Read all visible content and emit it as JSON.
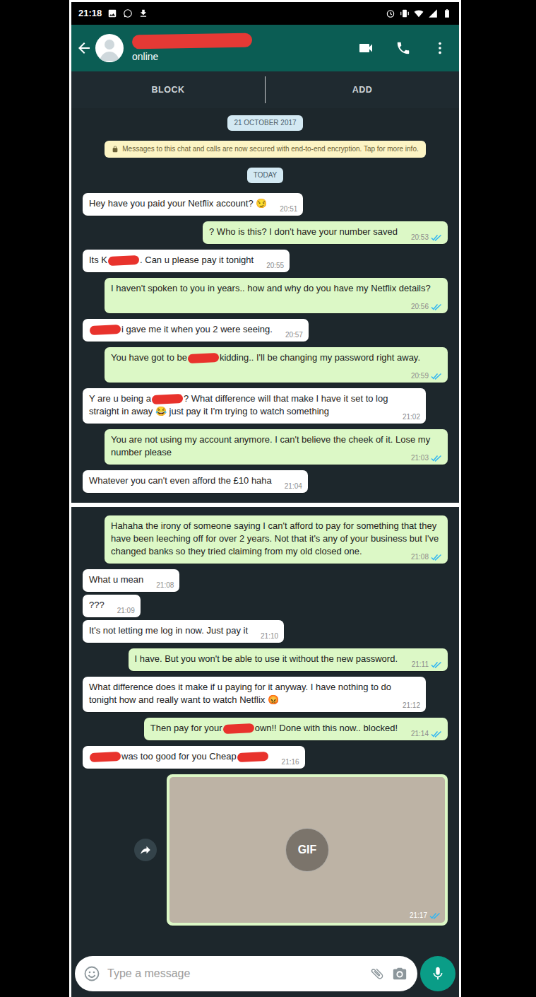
{
  "status_bar": {
    "time": "21:18"
  },
  "header": {
    "name_redacted": true,
    "status": "online"
  },
  "action_bar": {
    "buttons": [
      "BLOCK",
      "ADD"
    ]
  },
  "chips": {
    "date": "21 OCTOBER 2017",
    "encryption": "Messages to this chat and calls are now secured with end-to-end encryption. Tap for more info.",
    "day": "TODAY"
  },
  "screenshots": [
    {
      "messages": [
        {
          "kind": "incoming",
          "parts": [
            {
              "kind": "text",
              "text": "Hey have you paid your Netflix account? 😏"
            }
          ],
          "time": "20:51"
        },
        {
          "kind": "outgoing",
          "parts": [
            {
              "kind": "text",
              "text": "? Who is this? I don't have your number saved"
            }
          ],
          "time": "20:53",
          "read": true
        },
        {
          "kind": "incoming",
          "parts": [
            {
              "kind": "text",
              "text": "Its K"
            },
            {
              "kind": "redacted"
            },
            {
              "kind": "text",
              "text": ". Can u please pay it tonight"
            }
          ],
          "time": "20:55"
        },
        {
          "kind": "outgoing",
          "parts": [
            {
              "kind": "text",
              "text": "I haven't spoken to you in years.. how and why do you have my Netflix details?"
            }
          ],
          "time": "20:56",
          "read": true
        },
        {
          "kind": "incoming",
          "parts": [
            {
              "kind": "redacted"
            },
            {
              "kind": "text",
              "text": "i gave me it when you 2 were seeing."
            }
          ],
          "time": "20:57"
        },
        {
          "kind": "outgoing",
          "parts": [
            {
              "kind": "text",
              "text": "You have got to be"
            },
            {
              "kind": "redacted"
            },
            {
              "kind": "text",
              "text": "kidding.. I'll be changing my password right away."
            }
          ],
          "time": "20:59",
          "read": true
        },
        {
          "kind": "incoming",
          "parts": [
            {
              "kind": "text",
              "text": "Y are u being a"
            },
            {
              "kind": "redacted"
            },
            {
              "kind": "text",
              "text": "? What difference will that make I have it set to log straight in away 😂 just pay it I'm trying to watch something"
            }
          ],
          "time": "21:02"
        },
        {
          "kind": "outgoing",
          "parts": [
            {
              "kind": "text",
              "text": "You are not using my account anymore. I can't believe the cheek of it. Lose my number please"
            }
          ],
          "time": "21:03",
          "read": true
        },
        {
          "kind": "incoming",
          "parts": [
            {
              "kind": "text",
              "text": "Whatever you can't even afford the £10 haha"
            }
          ],
          "time": "21:04"
        }
      ]
    },
    {
      "messages": [
        {
          "kind": "outgoing",
          "parts": [
            {
              "kind": "text",
              "text": "Hahaha the irony of someone saying I can't afford to pay for something that they have been leeching off for over 2 years. Not that it's any of your business but I've changed banks so they tried claiming from my old closed one."
            }
          ],
          "time": "21:08",
          "read": true
        },
        {
          "kind": "incoming",
          "parts": [
            {
              "kind": "text",
              "text": "What u mean"
            }
          ],
          "time": "21:08"
        },
        {
          "kind": "incoming",
          "parts": [
            {
              "kind": "text",
              "text": "???"
            }
          ],
          "time": "21:09"
        },
        {
          "kind": "incoming",
          "parts": [
            {
              "kind": "text",
              "text": "It's not letting me log in now. Just pay it"
            }
          ],
          "time": "21:10"
        },
        {
          "kind": "outgoing",
          "parts": [
            {
              "kind": "text",
              "text": "I have. But you won't be able to use it without the new password."
            }
          ],
          "time": "21:11",
          "read": true
        },
        {
          "kind": "incoming",
          "parts": [
            {
              "kind": "text",
              "text": "What difference does it make if u paying for it anyway. I have nothing to do tonight how and really want to watch Netflix 😡"
            }
          ],
          "time": "21:12"
        },
        {
          "kind": "outgoing",
          "parts": [
            {
              "kind": "text",
              "text": "Then pay for your"
            },
            {
              "kind": "redacted"
            },
            {
              "kind": "text",
              "text": "own!! Done with this now.. blocked!"
            }
          ],
          "time": "21:14",
          "read": true
        },
        {
          "kind": "incoming",
          "parts": [
            {
              "kind": "redacted"
            },
            {
              "kind": "text",
              "text": "was too good for you Cheap"
            },
            {
              "kind": "redacted"
            }
          ],
          "time": "21:16"
        },
        {
          "kind": "gif",
          "label": "GIF",
          "time": "21:17",
          "read": true
        }
      ],
      "composer": {
        "placeholder": "Type a message"
      }
    }
  ]
}
